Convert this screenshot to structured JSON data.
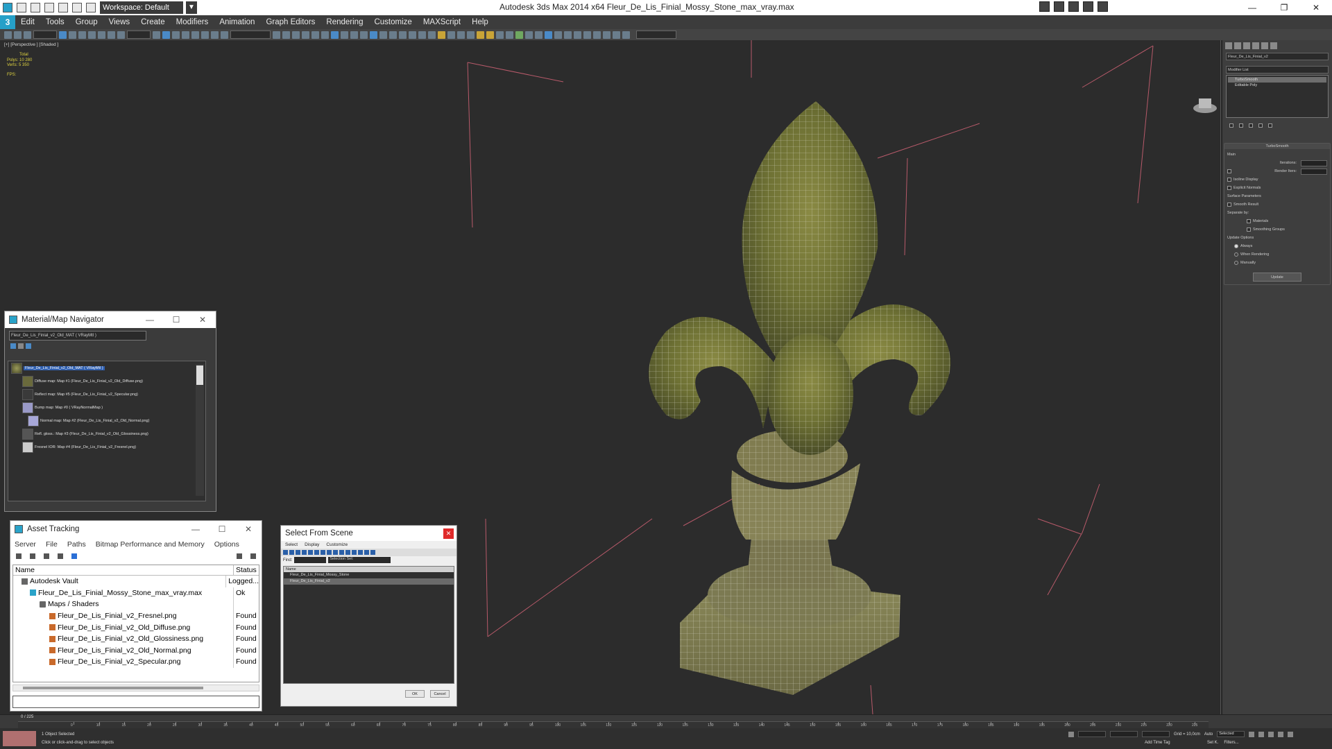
{
  "titlebar": {
    "workspace": "Workspace: Default",
    "title": "Autodesk 3ds Max  2014 x64     Fleur_De_Lis_Finial_Mossy_Stone_max_vray.max"
  },
  "menubar": {
    "logo": "3",
    "items": [
      "Edit",
      "Tools",
      "Group",
      "Views",
      "Create",
      "Modifiers",
      "Animation",
      "Graph Editors",
      "Rendering",
      "Customize",
      "MAXScript",
      "Help"
    ]
  },
  "viewport": {
    "label": "[+] [Perspective ] [Shaded ]",
    "stats": {
      "total": "Total",
      "polys": "Polys:  10 280",
      "verts": "Verts:   5 350",
      "fps": "FPS:"
    }
  },
  "command_panel": {
    "object_name": "Fleur_De_Lis_Finial_v2",
    "modifier_list": "Modifier List",
    "stack": [
      "TurboSmooth",
      "Editable Poly"
    ],
    "turbosmooth": {
      "title": "TurboSmooth",
      "main": "Main",
      "iterations": "Iterations:",
      "render_iters": "Render Iters:",
      "isoline": "Isoline Display",
      "explicit": "Explicit Normals"
    },
    "surface": {
      "title": "Surface Parameters",
      "smooth_result": "Smooth Result",
      "separate_by": "Separate by:",
      "materials": "Materials",
      "smoothing_groups": "Smoothing Groups"
    },
    "update": {
      "title": "Update Options",
      "always": "Always",
      "when_rendering": "When Rendering",
      "manually": "Manually",
      "button": "Update"
    }
  },
  "material_navigator": {
    "title": "Material/Map Navigator",
    "field": "Fleur_De_Lis_Finial_v2_Old_MAT  ( VRayMtl )",
    "root": "Fleur_De_Lis_Finial_v2_Old_MAT  ( VRayMtl )",
    "items": [
      "Diffuse map: Map #1 (Fleur_De_Lis_Finial_v2_Old_Diffuse.png)",
      "Reflect map: Map #5 (Fleur_De_Lis_Finial_v2_Specular.png)",
      "Bump map: Map #0  ( VRayNormalMap )",
      "Normal map: Map #2 (Fleur_De_Lis_Finial_v2_Old_Normal.png)",
      "Refl. gloss.: Map #3 (Fleur_De_Lis_Finial_v2_Old_Glossiness.png)",
      "Fresnel IOR: Map #4 (Fleur_De_Lis_Finial_v2_Fresnel.png)"
    ]
  },
  "asset_tracking": {
    "title": "Asset Tracking",
    "menu": [
      "Server",
      "File",
      "Paths",
      "Bitmap Performance and Memory",
      "Options"
    ],
    "columns": {
      "name": "Name",
      "status": "Status"
    },
    "rows": [
      {
        "name": "Autodesk Vault",
        "status": "Logged..."
      },
      {
        "name": "Fleur_De_Lis_Finial_Mossy_Stone_max_vray.max",
        "status": "Ok"
      },
      {
        "name": "Maps / Shaders",
        "status": ""
      },
      {
        "name": "Fleur_De_Lis_Finial_v2_Fresnel.png",
        "status": "Found"
      },
      {
        "name": "Fleur_De_Lis_Finial_v2_Old_Diffuse.png",
        "status": "Found"
      },
      {
        "name": "Fleur_De_Lis_Finial_v2_Old_Glossiness.png",
        "status": "Found"
      },
      {
        "name": "Fleur_De_Lis_Finial_v2_Old_Normal.png",
        "status": "Found"
      },
      {
        "name": "Fleur_De_Lis_Finial_v2_Specular.png",
        "status": "Found"
      }
    ]
  },
  "select_from_scene": {
    "title": "Select From Scene",
    "menu": [
      "Select",
      "Display",
      "Customize"
    ],
    "find_label": "Find:",
    "selection_set": "Selection Set:",
    "header": "Name",
    "items": [
      "Fleur_De_Lis_Finial_Mossy_Stone",
      "Fleur_De_Lis_Finial_v2"
    ],
    "ok": "OK",
    "cancel": "Cancel"
  },
  "timeline": {
    "frame": "0 / 225",
    "ticks": [
      "0",
      "10",
      "15",
      "20",
      "25",
      "30",
      "35",
      "40",
      "45",
      "50",
      "55",
      "60",
      "65",
      "70",
      "75",
      "80",
      "85",
      "90",
      "95",
      "100",
      "105",
      "110",
      "115",
      "120",
      "125",
      "130",
      "135",
      "140",
      "145",
      "150",
      "155",
      "160",
      "165",
      "170",
      "175",
      "180",
      "185",
      "190",
      "195",
      "200",
      "205",
      "210",
      "215",
      "220",
      "225"
    ]
  },
  "status": {
    "selected": "1 Object Selected",
    "hint": "Click or click-and-drag to select objects",
    "grid": "Grid = 10,0cm",
    "auto": "Auto",
    "selected_dd": "Selected",
    "set_key": "Set K.",
    "filters": "Filters...",
    "add_time_tag": "Add Time Tag"
  },
  "colors": {
    "accent": "#26a0c8",
    "selection": "#2f5fb0",
    "stat_text": "#e0d440"
  }
}
